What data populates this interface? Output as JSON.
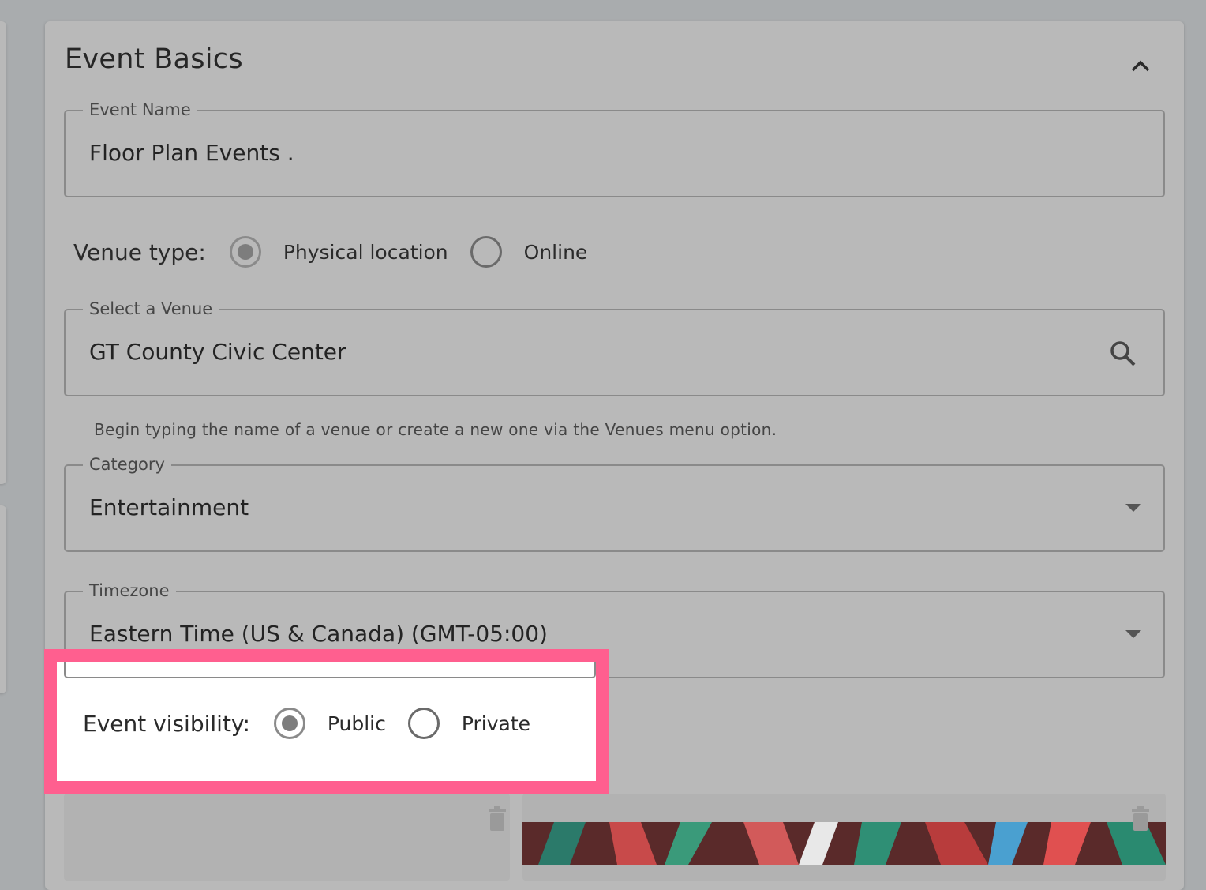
{
  "card": {
    "title": "Event Basics"
  },
  "event_name": {
    "label": "Event Name",
    "value": "Floor Plan Events ."
  },
  "venue_type": {
    "label": "Venue type:",
    "options": [
      "Physical location",
      "Online"
    ],
    "selected": "Physical location"
  },
  "venue": {
    "label": "Select a Venue",
    "value": "GT County Civic Center",
    "helper": "Begin typing the name of a venue or create a new one via the Venues menu option."
  },
  "category": {
    "label": "Category",
    "value": "Entertainment"
  },
  "timezone": {
    "label": "Timezone",
    "value": "Eastern Time (US & Canada) (GMT-05:00)"
  },
  "visibility": {
    "label": "Event visibility:",
    "options": [
      "Public",
      "Private"
    ],
    "selected": "Public"
  },
  "colors": {
    "highlight_border": "#ff5f8f",
    "overlay": "#a9acae"
  },
  "icons": {
    "collapse": "chevron-up-icon",
    "search": "search-icon",
    "dropdown": "caret-down-icon",
    "delete": "trash-icon"
  }
}
